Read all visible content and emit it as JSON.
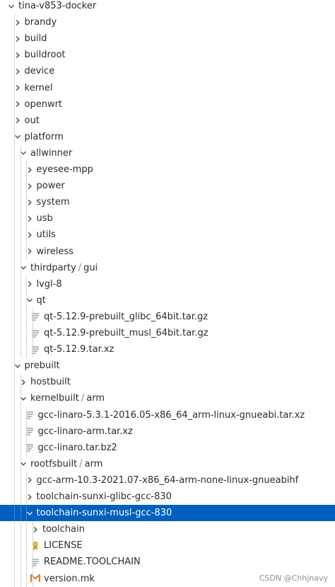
{
  "explorer": {
    "items": [
      {
        "label": "tina-v853-docker",
        "depth": 0,
        "kind": "folder",
        "open": true
      },
      {
        "label": "brandy",
        "depth": 1,
        "kind": "folder",
        "open": false
      },
      {
        "label": "build",
        "depth": 1,
        "kind": "folder",
        "open": false
      },
      {
        "label": "buildroot",
        "depth": 1,
        "kind": "folder",
        "open": false
      },
      {
        "label": "device",
        "depth": 1,
        "kind": "folder",
        "open": false
      },
      {
        "label": "kernel",
        "depth": 1,
        "kind": "folder",
        "open": false
      },
      {
        "label": "openwrt",
        "depth": 1,
        "kind": "folder",
        "open": false
      },
      {
        "label": "out",
        "depth": 1,
        "kind": "folder",
        "open": false
      },
      {
        "label": "platform",
        "depth": 1,
        "kind": "folder",
        "open": true
      },
      {
        "label": "allwinner",
        "depth": 2,
        "kind": "folder",
        "open": true
      },
      {
        "label": "eyesee-mpp",
        "depth": 3,
        "kind": "folder",
        "open": false
      },
      {
        "label": "power",
        "depth": 3,
        "kind": "folder",
        "open": false
      },
      {
        "label": "system",
        "depth": 3,
        "kind": "folder",
        "open": false
      },
      {
        "label": "usb",
        "depth": 3,
        "kind": "folder",
        "open": false
      },
      {
        "label": "utils",
        "depth": 3,
        "kind": "folder",
        "open": false
      },
      {
        "label": "wireless",
        "depth": 3,
        "kind": "folder",
        "open": false
      },
      {
        "label": "thirdparty",
        "sub": "gui",
        "depth": 2,
        "kind": "folder",
        "open": true
      },
      {
        "label": "lvgl-8",
        "depth": 3,
        "kind": "folder",
        "open": false
      },
      {
        "label": "qt",
        "depth": 3,
        "kind": "folder",
        "open": true
      },
      {
        "label": "qt-5.12.9-prebuilt_glibc_64bit.tar.gz",
        "depth": 4,
        "kind": "file",
        "icon": "lines-file-icon"
      },
      {
        "label": "qt-5.12.9-prebuilt_musl_64bit.tar.gz",
        "depth": 4,
        "kind": "file",
        "icon": "lines-file-icon"
      },
      {
        "label": "qt-5.12.9.tar.xz",
        "depth": 4,
        "kind": "file",
        "icon": "lines-file-icon"
      },
      {
        "label": "prebuilt",
        "depth": 1,
        "kind": "folder",
        "open": true
      },
      {
        "label": "hostbuilt",
        "depth": 2,
        "kind": "folder",
        "open": false
      },
      {
        "label": "kernelbuilt",
        "sub": "arm",
        "depth": 2,
        "kind": "folder",
        "open": true
      },
      {
        "label": "gcc-linaro-5.3.1-2016.05-x86_64_arm-linux-gnueabi.tar.xz",
        "depth": 3,
        "kind": "file",
        "icon": "lines-file-icon"
      },
      {
        "label": "gcc-linaro-arm.tar.xz",
        "depth": 3,
        "kind": "file",
        "icon": "lines-file-icon"
      },
      {
        "label": "gcc-linaro.tar.bz2",
        "depth": 3,
        "kind": "file",
        "icon": "lines-file-icon"
      },
      {
        "label": "rootfsbuilt",
        "sub": "arm",
        "depth": 2,
        "kind": "folder",
        "open": true
      },
      {
        "label": "gcc-arm-10.3-2021.07-x86_64-arm-none-linux-gnueabihf",
        "depth": 3,
        "kind": "folder",
        "open": false
      },
      {
        "label": "toolchain-sunxi-glibc-gcc-830",
        "depth": 3,
        "kind": "folder",
        "open": false
      },
      {
        "label": "toolchain-sunxi-musl-gcc-830",
        "depth": 3,
        "kind": "folder",
        "open": true,
        "selected": true
      },
      {
        "label": "toolchain",
        "depth": 4,
        "kind": "folder",
        "open": false
      },
      {
        "label": "LICENSE",
        "depth": 4,
        "kind": "file",
        "icon": "license-icon"
      },
      {
        "label": "README.TOOLCHAIN",
        "depth": 4,
        "kind": "file",
        "icon": "lines-file-icon"
      },
      {
        "label": "version.mk",
        "depth": 4,
        "kind": "file",
        "icon": "makefile-icon"
      }
    ],
    "colors": {
      "selection": "#0060c0",
      "text": "#2b2b2b",
      "license": "#c9a227",
      "makefile": "#e37933"
    }
  },
  "watermark": "CSDN @Chhjnavy"
}
